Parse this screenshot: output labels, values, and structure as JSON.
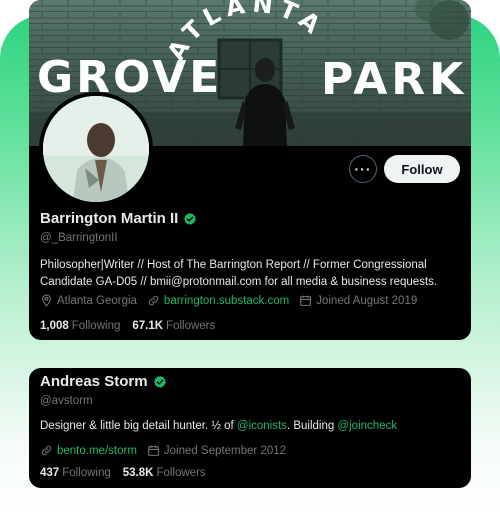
{
  "colors": {
    "accent": "#1fb86a",
    "card_bg": "#000000",
    "muted": "#71767b",
    "text": "#e7e9ea"
  },
  "profiles": [
    {
      "banner_text_arc": "ATLANTA",
      "banner_text_left": "GROVE",
      "banner_text_right": "PARK",
      "more_label": "···",
      "follow_label": "Follow",
      "name": "Barrington Martin II",
      "handle": "@_BarringtonII",
      "bio_line1": "Philosopher|Writer // Host of The Barrington Report // Former Congressional",
      "bio_line2": "Candidate GA-D05 // bmii@protonmail.com for all media & business requests.",
      "location": "Atlanta Georgia",
      "website": "barrington.substack.com",
      "joined": "Joined August 2019",
      "following_count": "1,008",
      "following_label": "Following",
      "followers_count": "67.1K",
      "followers_label": "Followers"
    },
    {
      "name": "Andreas Storm",
      "handle": "@avstorm",
      "bio_pre": "Designer & little big detail hunter. ½ of ",
      "bio_mention1": "@iconists",
      "bio_mid": ". Building ",
      "bio_mention2": "@joincheck",
      "website": "bento.me/storm",
      "joined": "Joined September 2012",
      "following_count": "437",
      "following_label": "Following",
      "followers_count": "53.8K",
      "followers_label": "Followers"
    }
  ]
}
